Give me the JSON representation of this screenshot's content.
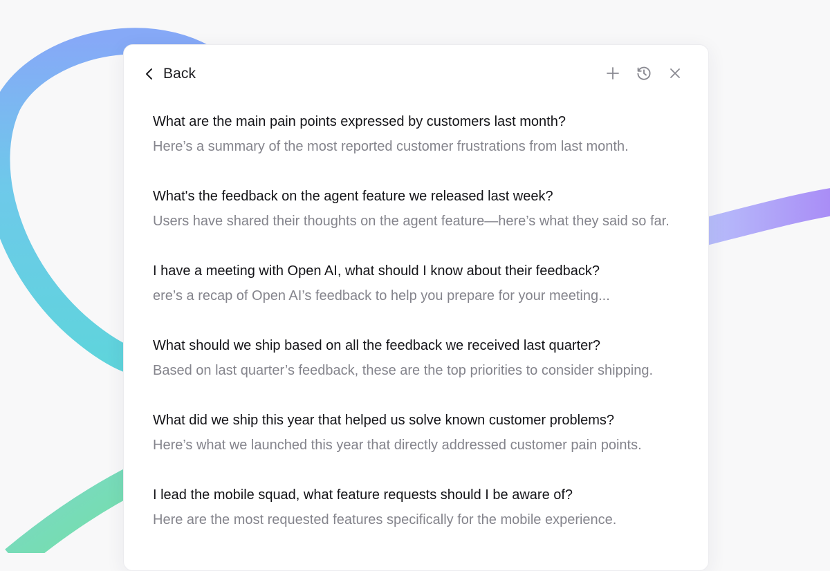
{
  "colors": {
    "background": "#f8f8f9",
    "panel": "#ffffff",
    "question_text": "#141418",
    "answer_text": "#84848c",
    "icon": "#8a8a92",
    "ribbon_start": "#6fd6e0",
    "ribbon_mid": "#7fb4f6",
    "ribbon_end": "#a98cf6"
  },
  "header": {
    "back_label": "Back",
    "icons": [
      "chevron-left-icon",
      "plus-icon",
      "history-icon",
      "close-icon"
    ]
  },
  "conversations": [
    {
      "question": "What are the main pain points expressed by customers last month?",
      "preview": "Here’s a summary of the most reported customer frustrations from last month."
    },
    {
      "question": "What's the feedback on the agent feature we released last week?",
      "preview": "Users have shared their thoughts on the agent feature—here’s what they said so far."
    },
    {
      "question": "I have a meeting with Open AI, what should I know about their feedback?",
      "preview": "ere’s a recap of Open AI’s feedback to help you prepare for your meeting..."
    },
    {
      "question": "What should we ship based on all the feedback we received last quarter?",
      "preview": "Based on last quarter’s feedback, these are the top priorities to consider shipping."
    },
    {
      "question": "What did we ship this year that helped us solve known customer problems?",
      "preview": "Here’s what we launched this year that directly addressed customer pain points."
    },
    {
      "question": "I lead the mobile squad, what feature requests should I be aware of?",
      "preview": "Here are the most requested features specifically for the mobile experience."
    }
  ]
}
